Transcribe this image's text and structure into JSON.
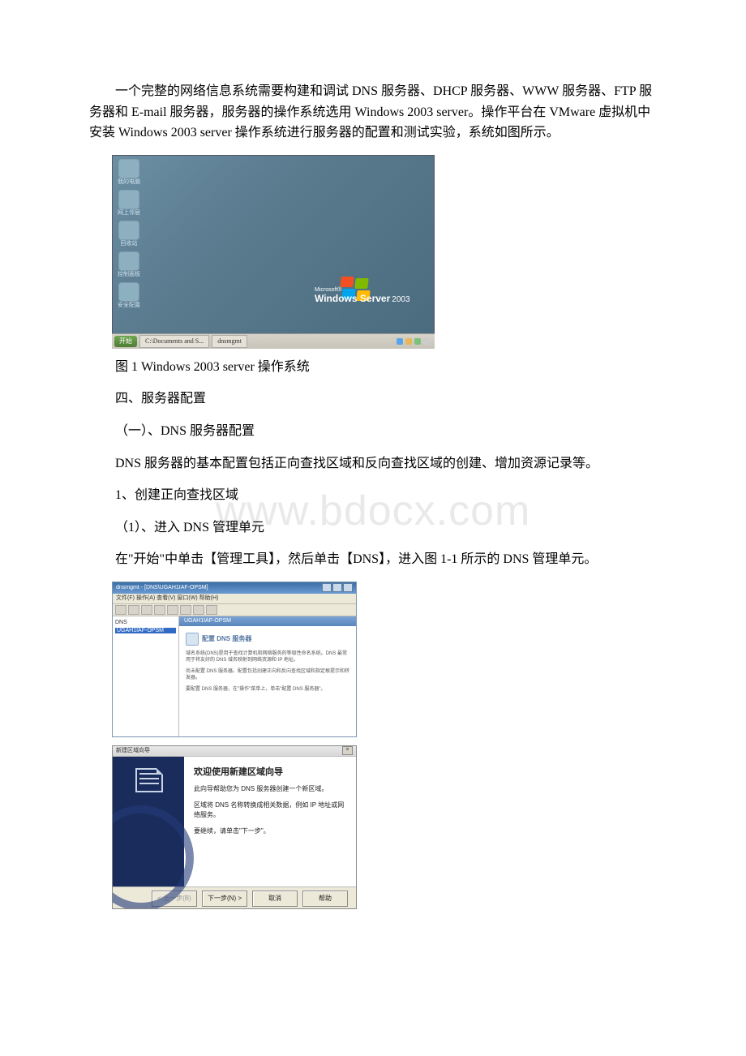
{
  "paragraphs": {
    "intro": "一个完整的网络信息系统需要构建和调试 DNS 服务器、DHCP 服务器、WWW 服务器、FTP 服务器和 E-mail 服务器，服务器的操作系统选用 Windows 2003 server。操作平台在 VMware 虚拟机中安装 Windows 2003 server 操作系统进行服务器的配置和测试实验，系统如图所示。",
    "caption1": "图 1 Windows 2003 server 操作系统",
    "heading4": "四、服务器配置",
    "heading4_1": "（一）、DNS 服务器配置",
    "dns_desc": "DNS 服务器的基本配置包括正向查找区域和反向查找区域的创建、增加资源记录等。",
    "step1": "1、创建正向查找区域",
    "step1_1": "（1）、进入 DNS 管理单元",
    "step1_1_desc": "在\"开始\"中单击【管理工具】，然后单击【DNS】，进入图 1-1 所示的 DNS 管理单元。"
  },
  "watermark": "www.bdocx.com",
  "desktop": {
    "icons": [
      "我的电脑",
      "网上邻居",
      "回收站",
      "控制面板",
      "安全配置"
    ],
    "brand_ms": "Microsoft®",
    "brand_main": "Windows Server",
    "brand_year": "2003",
    "taskbar": {
      "start": "开始",
      "buttons": [
        "C:\\Documents and S...",
        "dnsmgmt"
      ]
    }
  },
  "mmc": {
    "title": "dnsmgmt - [DNS\\UGAH1IAF-OPSM]",
    "menu": "文件(F)  操作(A)  查看(V)  窗口(W)  帮助(H)",
    "header": "UGAH1IAF-OPSM",
    "tree_root": "DNS",
    "tree_server": "UGAH1IAF-OPSM",
    "lead_title": "配置 DNS 服务器",
    "text1": "域名系统(DNS)是用于查找计算机和网络服务的等级性命名系统。DNS 最常用于将友好的 DNS 域名映射到网络资源和 IP 地址。",
    "text2": "尚未配置 DNS 服务器。配置包括创建正向和反向查找区域和指定根提示和转发器。",
    "text3": "要配置 DNS 服务器，在\"操作\"菜单上，单击\"配置 DNS 服务器\"。"
  },
  "wizard": {
    "title": "新建区域向导",
    "heading": "欢迎使用新建区域向导",
    "line1": "此向导帮助您为 DNS 服务器创建一个新区域。",
    "line2": "区域将 DNS 名称转换成相关数据，例如 IP 地址或网络服务。",
    "line3": "要继续，请单击\"下一步\"。",
    "buttons": {
      "back": "< 上一步(B)",
      "next": "下一步(N) >",
      "cancel": "取消",
      "help": "帮助"
    }
  }
}
